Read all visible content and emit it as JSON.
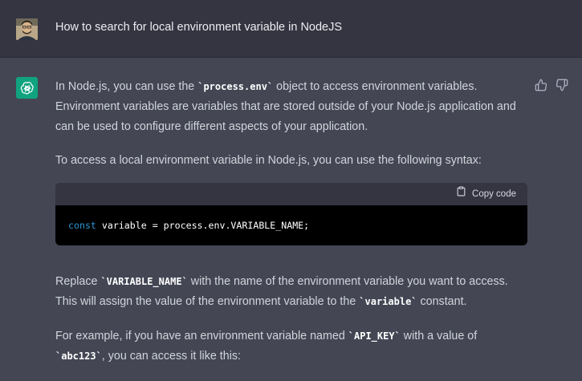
{
  "user": {
    "message": "How to search for local environment variable in NodeJS"
  },
  "assistant": {
    "p1": {
      "a": "In Node.js, you can use the ",
      "code": "`process.env`",
      "b": " object to access environment variables. Environment variables are variables that are stored outside of your Node.js application and can be used to configure different aspects of your application."
    },
    "p2": "To access a local environment variable in Node.js, you can use the following syntax:",
    "code_block": {
      "copy_label": "Copy code",
      "keyword": "const",
      "rest": " variable = process.env.VARIABLE_NAME;"
    },
    "p3": {
      "a": "Replace ",
      "code1": "`VARIABLE_NAME`",
      "b": " with the name of the environment variable you want to access. This will assign the value of the environment variable to the ",
      "code2": "`variable`",
      "c": " constant."
    },
    "p4": {
      "a": "For example, if you have an environment variable named ",
      "code1": "`API_KEY`",
      "b": " with a value of ",
      "code2": "`abc123`",
      "c": ", you can access it like this:"
    }
  },
  "colors": {
    "user_bg": "#343541",
    "assistant_bg": "#444654",
    "accent": "#10a37f",
    "keyword": "#2e95d3"
  },
  "icons": [
    "user-avatar",
    "openai-logo-icon",
    "thumbs-up-icon",
    "thumbs-down-icon",
    "clipboard-icon"
  ]
}
